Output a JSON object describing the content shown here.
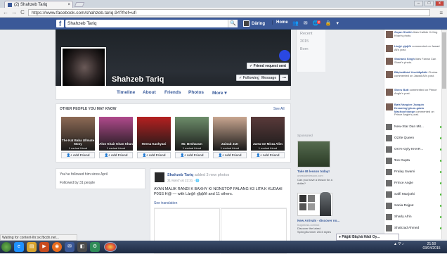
{
  "browser": {
    "tab_title": "(2) Shahzeb Tariq",
    "tab_close": "×",
    "url": "https://www.facebook.com/shahzeb.tariq.94?fref=ufi",
    "back": "←",
    "forward": "→",
    "reload": "C",
    "menu": "≡",
    "minimize": "–",
    "maximize": "□",
    "close": "x",
    "status": "Waiting for content-lhr.xx.fbcdn.net..."
  },
  "fb_header": {
    "logo": "f",
    "search_value": "Shahzeb Tariq",
    "search_icon": "🔍",
    "user_name": "Dâring",
    "home": "Home",
    "notif_badge": "2"
  },
  "profile": {
    "name": "Shahzeb Tariq",
    "friend_request_btn": "✓ Friend request sent",
    "follow_btn": "✓ Following",
    "message_btn": "Message",
    "more_btn": "•••",
    "tabs": [
      "Timeline",
      "About",
      "Friends",
      "Photos",
      "More ▾"
    ]
  },
  "timeline_years": [
    "Recent",
    "2015",
    "Born"
  ],
  "pymk": {
    "title": "OTHER PEOPLE YOU MAY KNOW",
    "see_all": "See All",
    "add_label": "Add Friend",
    "people": [
      {
        "name": "The Kat Baba Ullmate Mosy",
        "mutual": "1 mutual friend",
        "color": "#8d6a55"
      },
      {
        "name": "Alon Khair Khan Khan",
        "mutual": "1 mutual friend",
        "color": "#b04a8c"
      },
      {
        "name": "Heena Kashyani",
        "mutual": "",
        "color": "#b52020"
      },
      {
        "name": "Mr. Besharam",
        "mutual": "1 mutual friend",
        "color": "#6d8d6a"
      },
      {
        "name": "Zainab Jutt",
        "mutual": "1 mutual friend",
        "color": "#c9a690"
      },
      {
        "name": "Zarta Ge Mirza Alim",
        "mutual": "1 mutual friend",
        "color": "#5a3a3a"
      }
    ]
  },
  "left_info": [
    "You've followed him since April",
    "Followed by 31 people"
  ],
  "post": {
    "author": "Shahzeb Tariq",
    "action": "added 3 new photos",
    "time": "31 March at 22:31 · 🌐",
    "text": "AYAN MALIK RANDI K BAXHY KI NONSTOP PALANG K3 LITA K KUDAAI P0SS H@ — with Làrĝê ŋĭpƥľê and 11 others.",
    "see_translation": "See translation"
  },
  "ads": {
    "label": "Sponsored",
    "ad1": {
      "title": "Take IB lesson today!",
      "url": "onestolerlesson.com",
      "desc": "Can you have a lesson for a dollar?"
    },
    "ad2": {
      "title": "New Arrivals - discover no...",
      "url": "hugoboss.com/uk",
      "desc": "Discover the latest SpringSummer 2015 styles"
    }
  },
  "ticker": [
    {
      "name": "Zayan Sheikh",
      "rest": "likes Kalëdx X-King Khan's photo."
    },
    {
      "name": "Làrĝê ŋĭpƥľê",
      "rest": "commented on Jawad Ali's post."
    },
    {
      "name": "Shahank Singh",
      "rest": "likes Farran Can Sheel's photo."
    },
    {
      "name": "Bãçkståbèd Uneštåpåblè",
      "rest": "Chokra commented on Jawad Ali's post."
    },
    {
      "name": "Sheru Butt",
      "rest": "commented on Prince Angle's post."
    },
    {
      "name": "Bøts'Vangòre Joaquin Dreaming'ghum-gàsto Machoot'dòege",
      "rest": "commented on Prince Angle's post."
    }
  ],
  "chat": [
    "New-Xtar Dan Mit...",
    "Ozzle Queen",
    "Os?n-Oyly KHAR...",
    "Ɓıü Gupta",
    "Pralay Swami",
    "Prince Angle",
    "Saffi Manjothi",
    "Saniа Rajput",
    "Sharly Afrin",
    "Shahzad Ahmed"
  ],
  "chat_tab": "● Pâğăl Băçhâ Hădi Oy...",
  "taskbar": {
    "clock_time": "21:50",
    "clock_date": "03/04/2015",
    "tray": "▲ ⛛ ♪"
  },
  "colors": {
    "fb_blue": "#3b5998",
    "link": "#365899",
    "online": "#42b72a"
  }
}
